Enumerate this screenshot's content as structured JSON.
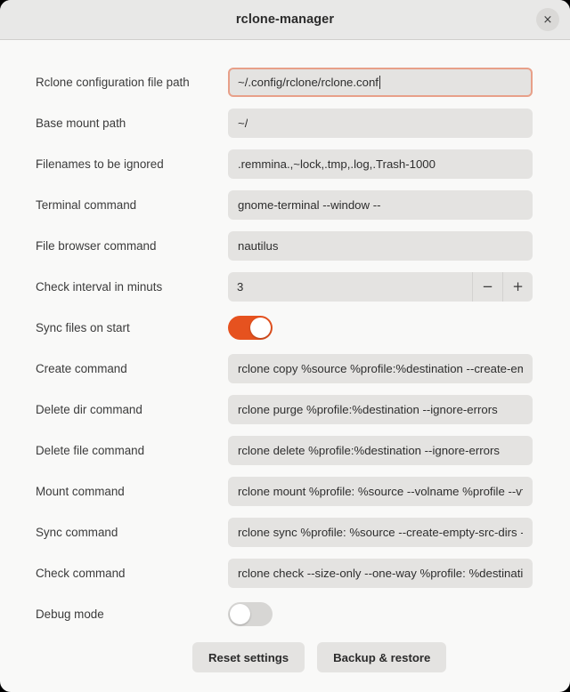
{
  "window": {
    "title": "rclone-manager",
    "close_icon": "close-icon",
    "close_glyph": "×",
    "accent_color": "#e6521f",
    "focus_border_color": "#e8a089",
    "titlebar_color": "#e8e8e7",
    "background_color": "#f9f9f8",
    "field_color": "#e4e3e1"
  },
  "settings": {
    "rows": [
      {
        "label": "Rclone configuration file path",
        "value": "~/.config/rclone/rclone.conf",
        "type": "text",
        "focused": true,
        "name": "rclone-config-path"
      },
      {
        "label": "Base mount path",
        "value": "~/",
        "type": "text",
        "focused": false,
        "name": "base-mount-path"
      },
      {
        "label": "Filenames to be ignored",
        "value": ".remmina.,~lock,.tmp,.log,.Trash-1000",
        "type": "text",
        "focused": false,
        "name": "ignored-filenames"
      },
      {
        "label": "Terminal command",
        "value": "gnome-terminal --window --",
        "type": "text",
        "focused": false,
        "name": "terminal-command"
      },
      {
        "label": "File browser command",
        "value": "nautilus",
        "type": "text",
        "focused": false,
        "name": "file-browser-command"
      },
      {
        "label": "Check interval in minuts",
        "value": "3",
        "type": "spinner",
        "decrement_glyph": "−",
        "increment_glyph": "+",
        "name": "check-interval"
      },
      {
        "label": "Sync files on start",
        "value": "on",
        "type": "toggle",
        "name": "sync-on-start"
      },
      {
        "label": "Create command",
        "value": "rclone copy %source %profile:%destination --create-empty-src-dirs",
        "type": "text",
        "focused": false,
        "name": "create-command"
      },
      {
        "label": "Delete dir command",
        "value": "rclone purge %profile:%destination --ignore-errors",
        "type": "text",
        "focused": false,
        "name": "delete-dir-command"
      },
      {
        "label": "Delete file command",
        "value": "rclone delete %profile:%destination --ignore-errors",
        "type": "text",
        "focused": false,
        "name": "delete-file-command"
      },
      {
        "label": "Mount command",
        "value": "rclone mount %profile: %source --volname %profile --vfs-cache-mode writes",
        "type": "text",
        "focused": false,
        "name": "mount-command"
      },
      {
        "label": "Sync command",
        "value": "rclone sync %profile: %source --create-empty-src-dirs --progress",
        "type": "text",
        "focused": false,
        "name": "sync-command"
      },
      {
        "label": "Check command",
        "value": "rclone check --size-only --one-way %profile: %destination",
        "type": "text",
        "focused": false,
        "name": "check-command"
      },
      {
        "label": "Debug mode",
        "value": "off",
        "type": "toggle",
        "name": "debug-mode"
      }
    ]
  },
  "actions": {
    "reset_label": "Reset settings",
    "backup_label": "Backup & restore"
  }
}
